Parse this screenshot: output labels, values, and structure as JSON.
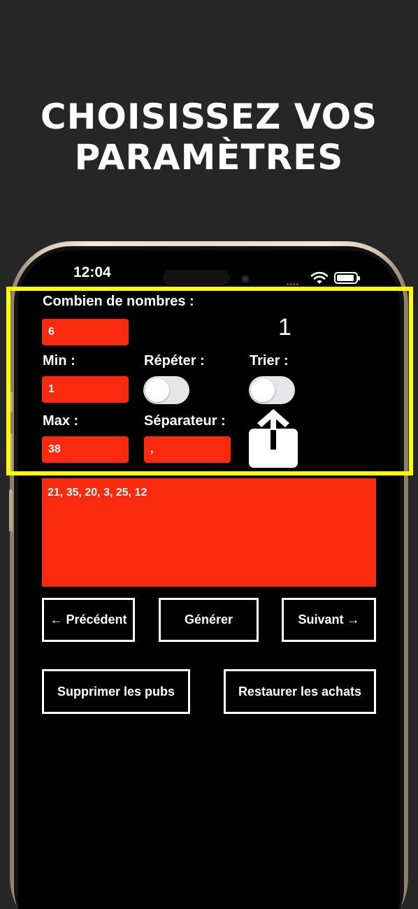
{
  "headline": {
    "line1": "CHOISISSEZ VOS",
    "line2": "PARAMÈTRES"
  },
  "status_bar": {
    "time": "12:04"
  },
  "form": {
    "count_label": "Combien de nombres :",
    "count_value": "6",
    "count_display": "1",
    "min_label": "Min :",
    "min_value": "1",
    "repeat_label": "Répéter :",
    "repeat_on": false,
    "sort_label": "Trier :",
    "sort_on": false,
    "max_label": "Max :",
    "max_value": "38",
    "separator_label": "Séparateur :",
    "separator_value": ","
  },
  "result": {
    "text": "21, 35, 20, 3, 25, 12"
  },
  "nav": {
    "previous": "← Précédent",
    "generate": "Générer",
    "next": "Suivant →"
  },
  "purchases": {
    "remove_ads": "Supprimer les pubs",
    "restore": "Restaurer les achats"
  },
  "colors": {
    "background": "#262626",
    "accent_red": "#fa2a0e",
    "highlight_yellow": "#ffff00",
    "phone_frame": "#e9dcc8"
  },
  "icons": [
    "wifi-icon",
    "battery-icon",
    "share-icon"
  ]
}
